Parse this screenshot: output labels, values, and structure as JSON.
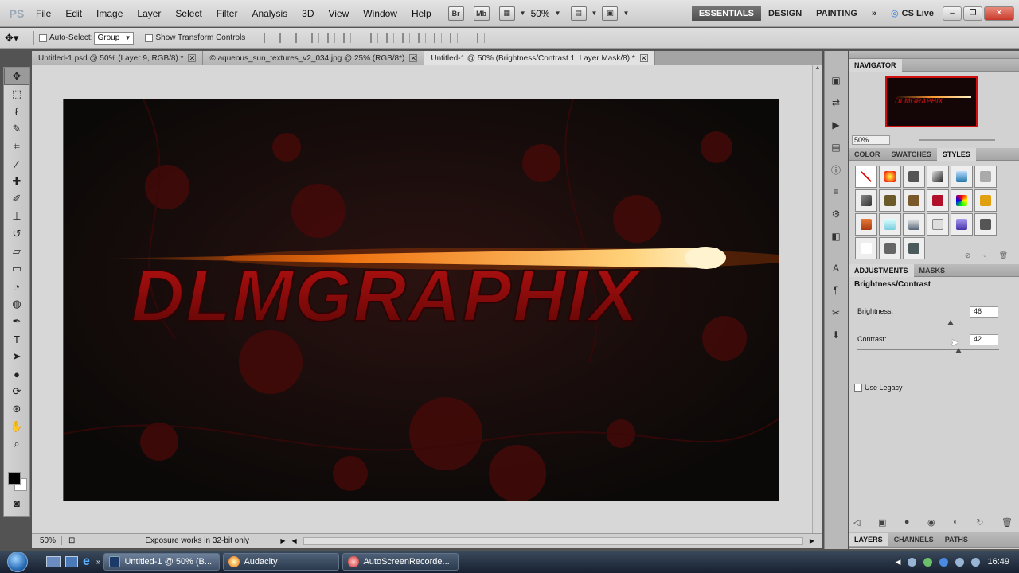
{
  "app": {
    "logo": "PS"
  },
  "menu": [
    "File",
    "Edit",
    "Image",
    "Layer",
    "Select",
    "Filter",
    "Analysis",
    "3D",
    "View",
    "Window",
    "Help"
  ],
  "menubar": {
    "br": "Br",
    "mb": "Mb",
    "zoom": "50%",
    "workspaces": [
      "ESSENTIALS",
      "DESIGN",
      "PAINTING"
    ],
    "more": "»",
    "cslive": "CS Live"
  },
  "options": {
    "auto_select": "Auto-Select:",
    "group": "Group",
    "show_transform": "Show Transform Controls"
  },
  "tabs": [
    {
      "label": "Untitled-1.psd @ 50% (Layer 9, RGB/8) *"
    },
    {
      "label": "© aqueous_sun_textures_v2_034.jpg @ 25% (RGB/8*)"
    },
    {
      "label": "Untitled-1 @ 50% (Brightness/Contrast 1, Layer Mask/8) *"
    }
  ],
  "canvas": {
    "text": "DLMGRAPHIX"
  },
  "status": {
    "zoom": "50%",
    "info": "Exposure works in 32-bit only"
  },
  "navigator": {
    "title": "NAVIGATOR",
    "zoom": "50%",
    "thumb_text": "DLMGRAPHIX"
  },
  "styles_panel": {
    "tabs": [
      "COLOR",
      "SWATCHES",
      "STYLES"
    ]
  },
  "adjustments": {
    "tabs": [
      "ADJUSTMENTS",
      "MASKS"
    ],
    "title": "Brightness/Contrast",
    "brightness_label": "Brightness:",
    "brightness": "46",
    "contrast_label": "Contrast:",
    "contrast": "42",
    "legacy": "Use Legacy"
  },
  "layers_tabs": [
    "LAYERS",
    "CHANNELS",
    "PATHS"
  ],
  "taskbar": {
    "items": [
      {
        "label": "Untitled-1 @ 50% (B..."
      },
      {
        "label": "Audacity"
      },
      {
        "label": "AutoScreenRecorde..."
      }
    ],
    "clock": "16:49"
  },
  "colors": {
    "accent": "#d01010",
    "canvas_bg": "#0f0b0a"
  }
}
